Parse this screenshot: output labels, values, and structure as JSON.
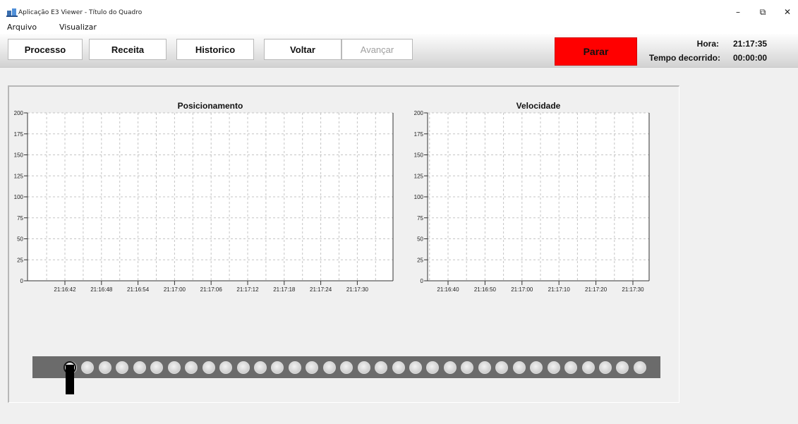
{
  "window": {
    "title": "Aplicação E3 Viewer - Título do Quadro",
    "icon": "e3-viewer-icon",
    "controls": {
      "minimize": "–",
      "restore": "⧉",
      "close": "✕"
    }
  },
  "menu": {
    "items": [
      "Arquivo",
      "Visualizar"
    ]
  },
  "toolbar": {
    "buttons": [
      "Processo",
      "Receita",
      "Historico",
      "Voltar",
      "Avançar"
    ],
    "disabled": [
      "Avançar"
    ],
    "stop_label": "Parar",
    "stop_color": "#ff0000"
  },
  "clock": {
    "hora_label": "Hora:",
    "hora_value": "21:17:35",
    "tempo_label": "Tempo decorrido:",
    "tempo_value": "00:00:00"
  },
  "chart_data": [
    {
      "type": "line",
      "title": "Posicionamento",
      "x": [
        "21:16:42",
        "21:16:48",
        "21:16:54",
        "21:17:00",
        "21:17:06",
        "21:17:12",
        "21:17:18",
        "21:17:24",
        "21:17:30"
      ],
      "series": [],
      "yticks": [
        0,
        25,
        50,
        75,
        100,
        125,
        150,
        175,
        200
      ],
      "ylim": [
        0,
        200
      ],
      "grid": true
    },
    {
      "type": "line",
      "title": "Velocidade",
      "x": [
        "21:16:40",
        "21:16:50",
        "21:17:00",
        "21:17:10",
        "21:17:20",
        "21:17:30"
      ],
      "series": [],
      "yticks": [
        0,
        25,
        50,
        75,
        100,
        125,
        150,
        175,
        200
      ],
      "ylim": [
        0,
        200
      ],
      "grid": true
    }
  ],
  "conveyor": {
    "roller_count": 34,
    "marker_position": 1,
    "belt_color": "#6b6b6b"
  }
}
